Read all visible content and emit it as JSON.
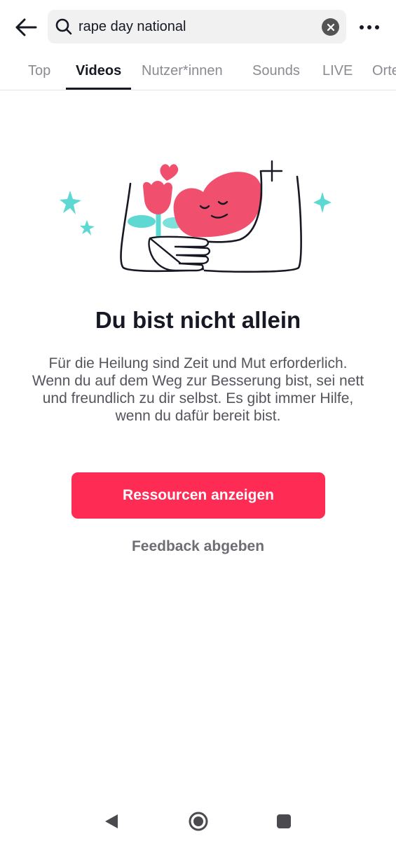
{
  "header": {
    "back_icon": "arrow-left-icon",
    "search": {
      "value": "rape day national",
      "placeholder": "",
      "icon": "search-icon",
      "clear_icon": "clear-icon"
    },
    "more_icon": "more-horizontal-icon"
  },
  "tabs": [
    {
      "label": "Top",
      "active": false
    },
    {
      "label": "Videos",
      "active": true
    },
    {
      "label": "Nutzer*innen",
      "active": false
    },
    {
      "label": "Sounds",
      "active": false
    },
    {
      "label": "LIVE",
      "active": false
    },
    {
      "label": "Orte",
      "active": false
    }
  ],
  "main": {
    "illustration_icon": "heart-hug-illustration",
    "title": "Du bist nicht allein",
    "body": "Für die Heilung sind Zeit und Mut erforderlich. Wenn du auf dem Weg zur Besserung bist, sei nett und freundlich zu dir selbst. Es gibt immer Hilfe, wenn du dafür bereit bist.",
    "primary_button": "Ressourcen anzeigen",
    "secondary_link": "Feedback abgeben"
  },
  "navbar": {
    "back_icon": "nav-back-icon",
    "home_icon": "nav-home-icon",
    "recents_icon": "nav-recents-icon"
  },
  "colors": {
    "accent": "#fe2c55",
    "text_primary": "#161823",
    "text_secondary": "#54555c",
    "search_bg": "#f1f1f2",
    "teal": "#5ed8d2",
    "pink": "#f0506e"
  }
}
